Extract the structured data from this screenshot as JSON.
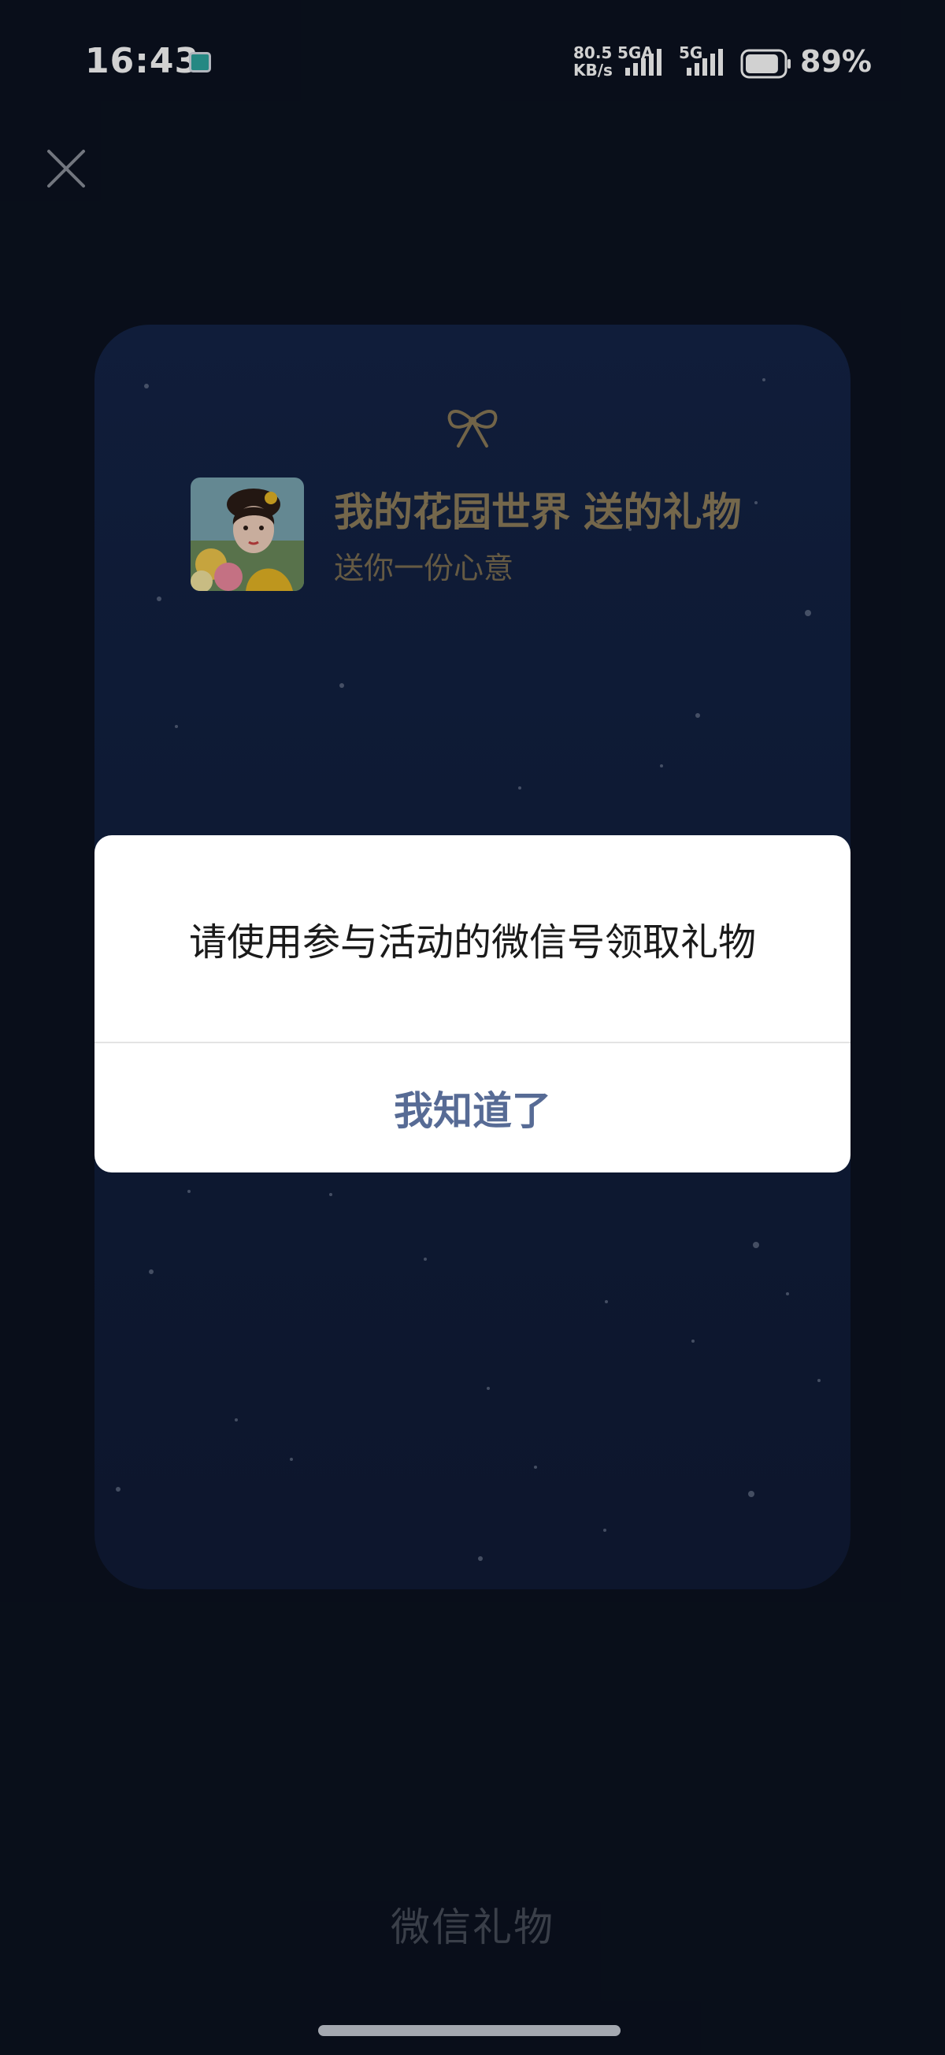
{
  "status_bar": {
    "time": "16:43",
    "net_speed_value": "80.5",
    "net_speed_unit": "KB/s",
    "network_1": "5GA",
    "network_2": "5G",
    "battery_percent": "89%",
    "battery_level": 0.89
  },
  "gift_card": {
    "title": "我的花园世界 送的礼物",
    "subtitle": "送你一份心意"
  },
  "dialog": {
    "message": "请使用参与活动的微信号领取礼物",
    "button_label": "我知道了"
  },
  "footer": {
    "brand": "微信礼物"
  },
  "icons": {
    "close": "close-icon",
    "bow": "bow-icon",
    "app_notification": "tv-app-icon"
  },
  "colors": {
    "background": "#0b1220",
    "card": "#132343",
    "gold_text": "#8e7e5c",
    "dialog_button": "#576b95"
  }
}
